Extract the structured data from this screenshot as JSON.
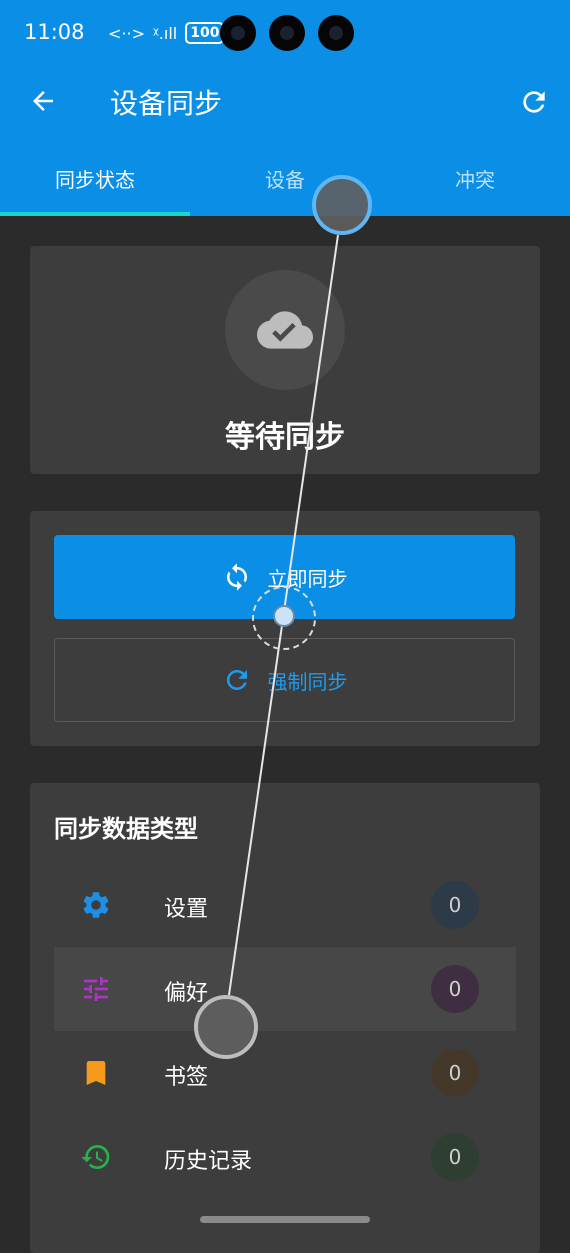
{
  "status_bar": {
    "time": "11:08",
    "network": "<··>",
    "signal": "ᵡ.ıll",
    "battery": "100"
  },
  "toolbar": {
    "title": "设备同步",
    "back_icon": "arrow-left-icon",
    "refresh_icon": "refresh-icon"
  },
  "tabs": [
    {
      "label": "同步状态",
      "active": true
    },
    {
      "label": "设备",
      "active": false
    },
    {
      "label": "冲突",
      "active": false
    }
  ],
  "status_card": {
    "icon": "cloud-check-icon",
    "text": "等待同步"
  },
  "actions": {
    "sync_now": "立即同步",
    "force_sync": "强制同步"
  },
  "data_types": {
    "title": "同步数据类型",
    "items": [
      {
        "label": "设置",
        "count": "0",
        "icon": "gear-icon",
        "color": "#1e8fe6"
      },
      {
        "label": "偏好",
        "count": "0",
        "icon": "sliders-icon",
        "color": "#b032c8"
      },
      {
        "label": "书签",
        "count": "0",
        "icon": "bookmark-icon",
        "color": "#f59a1b"
      },
      {
        "label": "历史记录",
        "count": "0",
        "icon": "history-icon",
        "color": "#27b24a"
      }
    ]
  },
  "colors": {
    "primary": "#0b8fe6",
    "tab_indicator": "#19d6c8",
    "background": "#2b2b2b",
    "card": "#3d3d3d"
  }
}
